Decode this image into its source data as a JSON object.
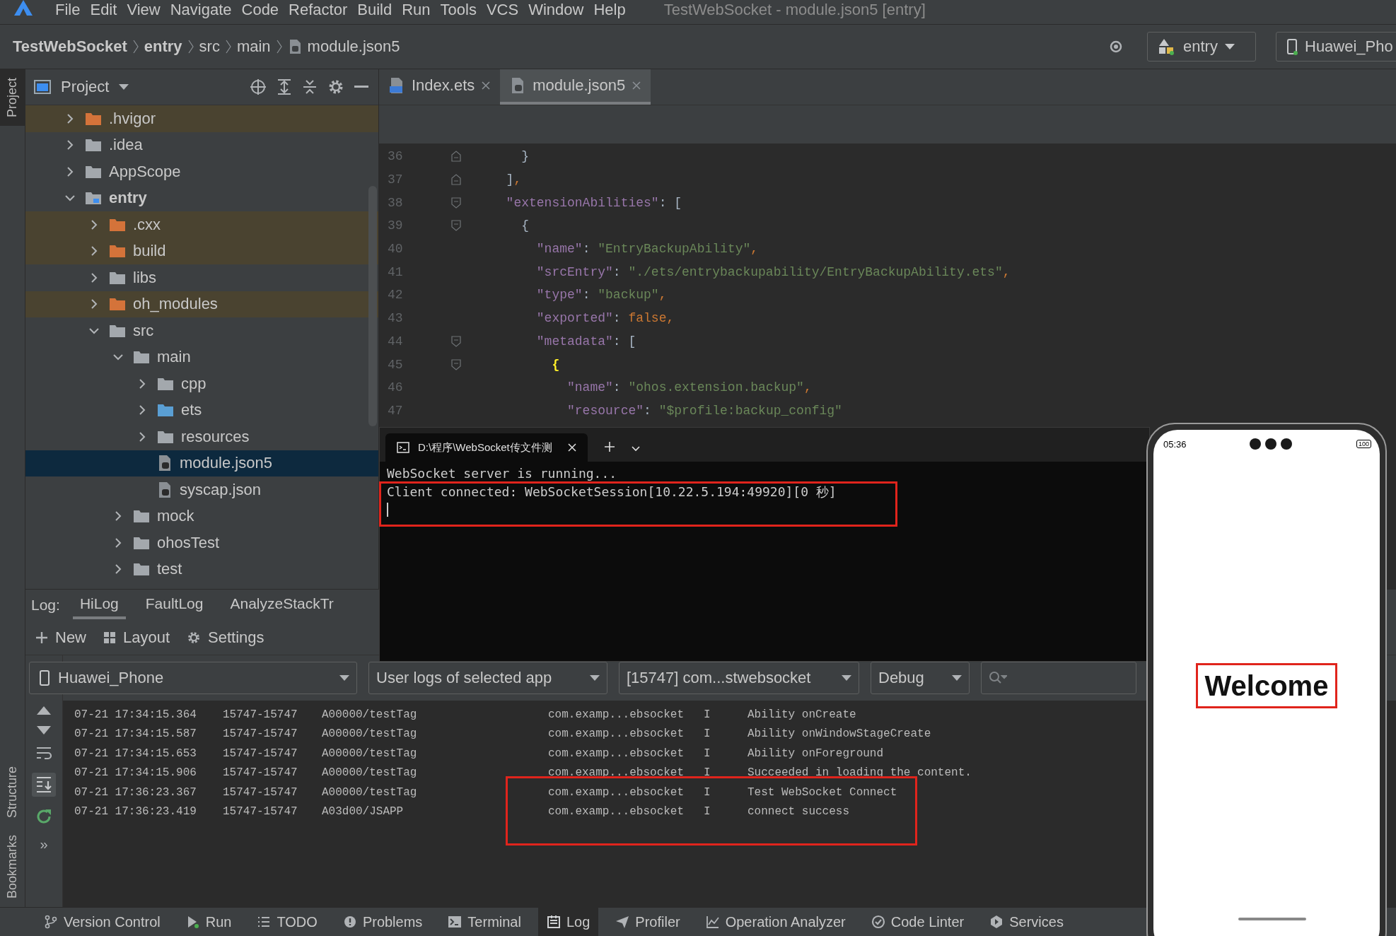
{
  "menu_bar": {
    "items": [
      "File",
      "Edit",
      "View",
      "Navigate",
      "Code",
      "Refactor",
      "Build",
      "Run",
      "Tools",
      "VCS",
      "Window",
      "Help"
    ],
    "title": "TestWebSocket - module.json5 [entry]"
  },
  "breadcrumb": [
    {
      "label": "TestWebSocket",
      "bold": true
    },
    {
      "label": "entry",
      "bold": true
    },
    {
      "label": "src",
      "bold": false
    },
    {
      "label": "main",
      "bold": false
    },
    {
      "label": "module.json5",
      "bold": false
    }
  ],
  "run_config": "entry",
  "device": "Huawei_Pho",
  "side_strip": {
    "top": [
      {
        "label": "Project",
        "selected": true
      }
    ],
    "bottom": [
      {
        "label": "Structure",
        "selected": false
      },
      {
        "label": "Bookmarks",
        "selected": false
      }
    ]
  },
  "project_panel": {
    "title": "Project"
  },
  "project_tree": [
    {
      "label": ".hvigor",
      "kind": "excluded",
      "expanded": false,
      "selected": false
    },
    {
      "label": ".idea",
      "kind": "folder",
      "expanded": false,
      "selected": false
    },
    {
      "label": "AppScope",
      "kind": "folder",
      "expanded": false,
      "selected": false
    },
    {
      "label": "entry",
      "kind": "module",
      "expanded": true,
      "selected": false,
      "children": [
        {
          "label": ".cxx",
          "kind": "excluded",
          "expanded": false,
          "selected": false
        },
        {
          "label": "build",
          "kind": "excluded",
          "expanded": false,
          "selected": false
        },
        {
          "label": "libs",
          "kind": "folder",
          "expanded": false,
          "selected": false
        },
        {
          "label": "oh_modules",
          "kind": "excluded",
          "expanded": false,
          "selected": false
        },
        {
          "label": "src",
          "kind": "folder",
          "expanded": true,
          "selected": false,
          "children": [
            {
              "label": "main",
              "kind": "folder",
              "expanded": true,
              "selected": false,
              "children": [
                {
                  "label": "cpp",
                  "kind": "folder",
                  "expanded": false,
                  "selected": false
                },
                {
                  "label": "ets",
                  "kind": "source",
                  "expanded": false,
                  "selected": false
                },
                {
                  "label": "resources",
                  "kind": "folder",
                  "expanded": false,
                  "selected": false
                },
                {
                  "label": "module.json5",
                  "kind": "file",
                  "selected": true
                },
                {
                  "label": "syscap.json",
                  "kind": "file",
                  "selected": false
                }
              ]
            },
            {
              "label": "mock",
              "kind": "folder",
              "expanded": false,
              "selected": false
            },
            {
              "label": "ohosTest",
              "kind": "folder",
              "expanded": false,
              "selected": false
            },
            {
              "label": "test",
              "kind": "folder",
              "expanded": false,
              "selected": false
            }
          ]
        }
      ]
    }
  ],
  "editor_tabs": [
    {
      "label": "Index.ets",
      "kind": "ets",
      "selected": false
    },
    {
      "label": "module.json5",
      "kind": "json",
      "selected": true
    }
  ],
  "code_lines": [
    {
      "number": "36",
      "kind": "fold-end",
      "tokens": [
        {
          "kind": "punct",
          "text": "    }"
        }
      ]
    },
    {
      "number": "37",
      "kind": "fold-end",
      "tokens": [
        {
          "kind": "punct",
          "text": "  ]"
        },
        {
          "kind": "keyword",
          "text": ","
        }
      ]
    },
    {
      "number": "38",
      "kind": "fold-start",
      "tokens": [
        {
          "kind": "key",
          "text": "  \"extensionAbilities\""
        },
        {
          "kind": "punct",
          "text": ": ["
        }
      ]
    },
    {
      "number": "39",
      "kind": "fold-start",
      "tokens": [
        {
          "kind": "punct",
          "text": "    {"
        }
      ]
    },
    {
      "number": "40",
      "kind": "plain",
      "tokens": [
        {
          "kind": "key",
          "text": "      \"name\""
        },
        {
          "kind": "punct",
          "text": ": "
        },
        {
          "kind": "string",
          "text": "\"EntryBackupAbility\""
        },
        {
          "kind": "keyword",
          "text": ","
        }
      ]
    },
    {
      "number": "41",
      "kind": "plain",
      "tokens": [
        {
          "kind": "key",
          "text": "      \"srcEntry\""
        },
        {
          "kind": "punct",
          "text": ": "
        },
        {
          "kind": "string",
          "text": "\"./ets/entrybackupability/EntryBackupAbility.ets\""
        },
        {
          "kind": "keyword",
          "text": ","
        }
      ]
    },
    {
      "number": "42",
      "kind": "plain",
      "tokens": [
        {
          "kind": "key",
          "text": "      \"type\""
        },
        {
          "kind": "punct",
          "text": ": "
        },
        {
          "kind": "string",
          "text": "\"backup\""
        },
        {
          "kind": "keyword",
          "text": ","
        }
      ]
    },
    {
      "number": "43",
      "kind": "plain",
      "tokens": [
        {
          "kind": "key",
          "text": "      \"exported\""
        },
        {
          "kind": "punct",
          "text": ": "
        },
        {
          "kind": "keyword",
          "text": "false,"
        }
      ]
    },
    {
      "number": "44",
      "kind": "fold-start",
      "tokens": [
        {
          "kind": "key",
          "text": "      \"metadata\""
        },
        {
          "kind": "punct",
          "text": ": ["
        }
      ]
    },
    {
      "number": "45",
      "kind": "fold-start",
      "tokens": [
        {
          "kind": "brace",
          "text": "        {"
        }
      ]
    },
    {
      "number": "46",
      "kind": "plain",
      "tokens": [
        {
          "kind": "key",
          "text": "          \"name\""
        },
        {
          "kind": "punct",
          "text": ": "
        },
        {
          "kind": "string",
          "text": "\"ohos.extension.backup\""
        },
        {
          "kind": "keyword",
          "text": ","
        }
      ]
    },
    {
      "number": "47",
      "kind": "plain",
      "tokens": [
        {
          "kind": "key",
          "text": "          \"resource\""
        },
        {
          "kind": "punct",
          "text": ": "
        },
        {
          "kind": "string",
          "text": "\"$profile:backup_config\""
        }
      ]
    }
  ],
  "terminal": {
    "tab_title": "D:\\程序\\WebSocket传文件测",
    "lines": [
      "WebSocket server is running...",
      "Client connected: WebSocketSession[10.22.5.194:49920][0 秒]"
    ]
  },
  "log_panel": {
    "label": "Log:",
    "tabs": [
      {
        "label": "HiLog",
        "selected": true
      },
      {
        "label": "FaultLog",
        "selected": false
      },
      {
        "label": "AnalyzeStackTr",
        "selected": false
      }
    ],
    "toolbar": [
      "New",
      "Layout",
      "Settings"
    ],
    "filters": {
      "device": "Huawei_Phone",
      "scope": "User logs of selected app",
      "process": "[15747] com...stwebsocket",
      "level": "Debug"
    },
    "more": "»",
    "rows": [
      {
        "time": "07-21 17:34:15.364",
        "pid": "15747-15747",
        "tag": "A00000/testTag",
        "package": "com.examp...ebsocket",
        "level": "I",
        "message": "Ability onCreate"
      },
      {
        "time": "07-21 17:34:15.587",
        "pid": "15747-15747",
        "tag": "A00000/testTag",
        "package": "com.examp...ebsocket",
        "level": "I",
        "message": "Ability onWindowStageCreate"
      },
      {
        "time": "07-21 17:34:15.653",
        "pid": "15747-15747",
        "tag": "A00000/testTag",
        "package": "com.examp...ebsocket",
        "level": "I",
        "message": "Ability onForeground"
      },
      {
        "time": "07-21 17:34:15.906",
        "pid": "15747-15747",
        "tag": "A00000/testTag",
        "package": "com.examp...ebsocket",
        "level": "I",
        "message": "Succeeded in loading the content."
      },
      {
        "time": "07-21 17:36:23.367",
        "pid": "15747-15747",
        "tag": "A00000/testTag",
        "package": "com.examp...ebsocket",
        "level": "I",
        "message": "Test WebSocket Connect"
      },
      {
        "time": "07-21 17:36:23.419",
        "pid": "15747-15747",
        "tag": "A03d00/JSAPP",
        "package": "com.examp...ebsocket",
        "level": "I",
        "message": "connect success"
      }
    ]
  },
  "bottom_bar": [
    {
      "label": "Version Control",
      "kind": "branch",
      "selected": false
    },
    {
      "label": "Run",
      "kind": "run",
      "selected": false
    },
    {
      "label": "TODO",
      "kind": "list",
      "selected": false
    },
    {
      "label": "Problems",
      "kind": "alert",
      "selected": false
    },
    {
      "label": "Terminal",
      "kind": "terminal",
      "selected": false
    },
    {
      "label": "Log",
      "kind": "log",
      "selected": true
    },
    {
      "label": "Profiler",
      "kind": "plane",
      "selected": false
    },
    {
      "label": "Operation Analyzer",
      "kind": "chart",
      "selected": false
    },
    {
      "label": "Code Linter",
      "kind": "lint",
      "selected": false
    },
    {
      "label": "Services",
      "kind": "services",
      "selected": false
    }
  ],
  "phone": {
    "time": "05:36",
    "battery": "100",
    "text": "Welcome"
  }
}
